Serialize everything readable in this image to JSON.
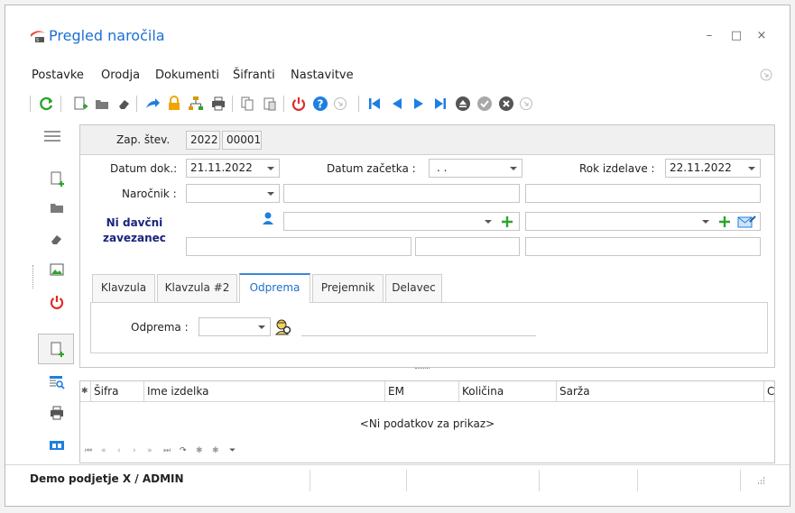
{
  "window": {
    "title": "Pregled naročila",
    "minimize_glyph": "–",
    "maximize_glyph": "□",
    "close_glyph": "×"
  },
  "menu": {
    "items": [
      "Postavke",
      "Orodja",
      "Dokumenti",
      "Šifranti",
      "Nastavitve"
    ]
  },
  "header": {
    "zap_label": "Zap. štev.",
    "zap_year": "2022",
    "zap_number": "00001",
    "datum_dok_label": "Datum dok.:",
    "datum_dok_value": "21.11.2022",
    "datum_zacetka_label": "Datum začetka :",
    "datum_zacetka_value": ". .",
    "rok_label": "Rok izdelave :",
    "rok_value": "22.11.2022",
    "narocnik_label": "Naročnik :",
    "davcni_line1": "Ni davčni",
    "davcni_line2": "zavezanec"
  },
  "tabs": [
    "Klavzula",
    "Klavzula #2",
    "Odprema",
    "Prejemnik",
    "Delavec"
  ],
  "active_tab": "Odprema",
  "odprema": {
    "label": "Odprema :"
  },
  "grid": {
    "columns": [
      "Šifra",
      "Ime izdelka",
      "EM",
      "Količina",
      "Sarža",
      "C"
    ],
    "empty_text": "<Ni podatkov za prikaz>",
    "nav_glyphs": [
      "⏮",
      "«",
      "‹",
      "›",
      "»",
      "⏭",
      "↷",
      "✱",
      "✱",
      "⏷"
    ]
  },
  "statusbar": {
    "company_user": "Demo podjetje X / ADMIN"
  },
  "colors": {
    "title_blue": "#1d6fd1",
    "accent_green": "#2aa52a",
    "accent_red": "#e02a2a",
    "navy_label": "#1a237e",
    "nav_blue": "#1e7fe0"
  }
}
